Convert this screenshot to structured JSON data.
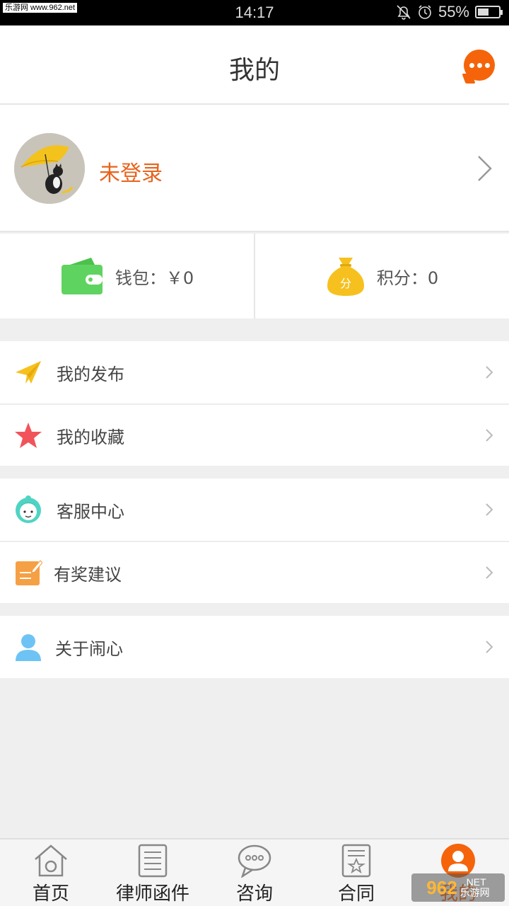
{
  "status_bar": {
    "watermark_text": "乐游网 www.962.net",
    "time": "14:17",
    "battery": "55%",
    "battery_level": 0.55
  },
  "header": {
    "title": "我的"
  },
  "profile": {
    "login_text": "未登录"
  },
  "stats": {
    "wallet": "钱包：￥0",
    "points": "积分：0",
    "points_badge": "分"
  },
  "menu": {
    "group1": [
      {
        "label": "我的发布",
        "icon": "paper-plane-icon"
      },
      {
        "label": "我的收藏",
        "icon": "star-icon"
      }
    ],
    "group2": [
      {
        "label": "客服中心",
        "icon": "customer-service-icon"
      },
      {
        "label": "有奖建议",
        "icon": "note-edit-icon"
      }
    ],
    "group3": [
      {
        "label": "关于闹心",
        "icon": "user-icon"
      }
    ]
  },
  "tabs": [
    {
      "label": "首页",
      "icon": "home-icon"
    },
    {
      "label": "律师函件",
      "icon": "document-icon"
    },
    {
      "label": "咨询",
      "icon": "chat-bubble-icon"
    },
    {
      "label": "合同",
      "icon": "contract-icon"
    },
    {
      "label": "我的",
      "icon": "profile-icon",
      "active": true
    }
  ],
  "watermark": {
    "number": "962",
    "line1": ".NET",
    "line2": "乐游网"
  },
  "colors": {
    "accent": "#f5640a",
    "login_text": "#e8631d",
    "wallet_green": "#5fd35f",
    "points_gold": "#f6c11f",
    "star_red": "#f2535b",
    "plane_yellow": "#f6c11f",
    "service_teal": "#4fd4c4",
    "note_orange": "#f5a045",
    "user_blue": "#6ec3f5"
  }
}
